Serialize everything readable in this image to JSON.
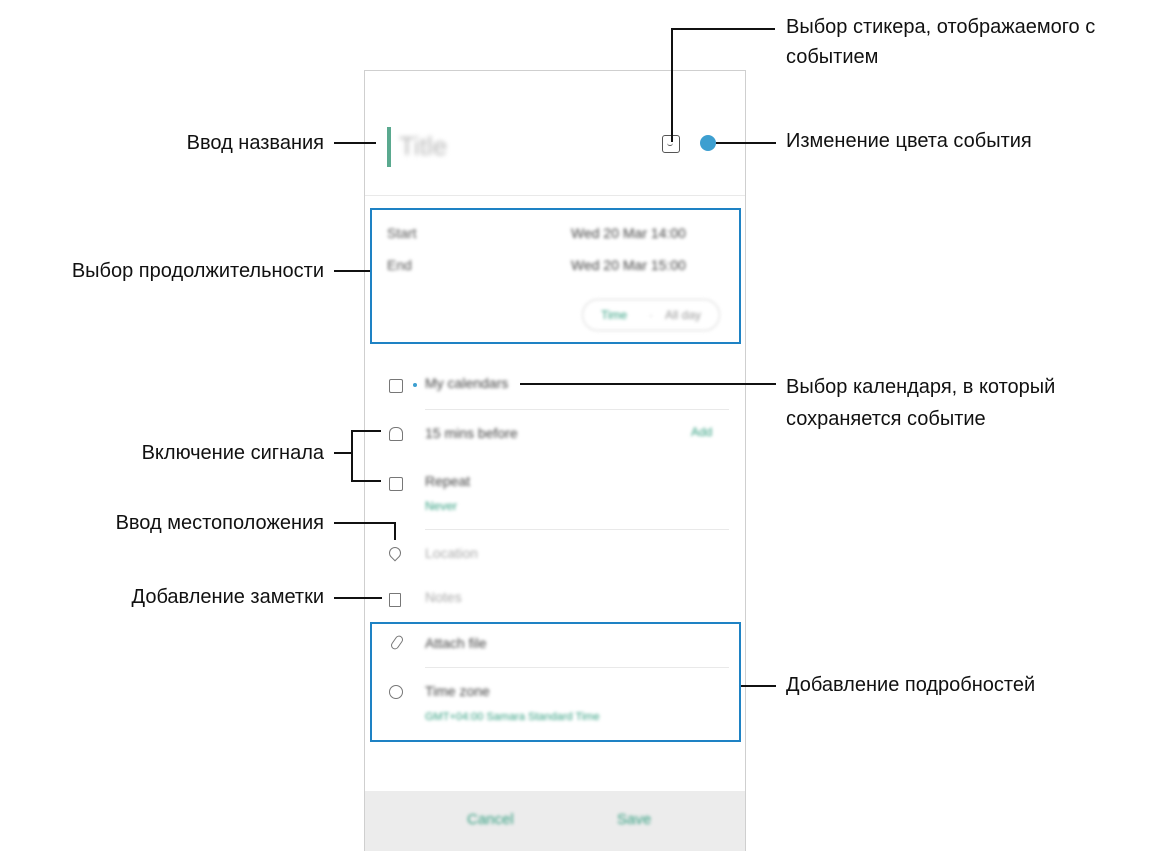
{
  "screen": {
    "title_placeholder": "Title",
    "duration": {
      "start_label": "Start",
      "start_value": "Wed 20 Mar 14:00",
      "end_label": "End",
      "end_value": "Wed 20 Mar 15:00",
      "toggle_time": "Time",
      "toggle_allday": "All day"
    },
    "calendar": "My calendars",
    "alarm": {
      "value": "15 mins before",
      "action": "Add"
    },
    "repeat": {
      "label": "Repeat",
      "value": "Never"
    },
    "location_placeholder": "Location",
    "notes_placeholder": "Notes",
    "attach": "Attach file",
    "timezone": {
      "label": "Time zone",
      "value": "GMT+04:00 Samara Standard Time"
    },
    "cancel_label": "Cancel",
    "save_label": "Save"
  },
  "callouts": {
    "sticker": "Выбор стикера, отображаемого с событием",
    "sticker_line1": "Выбор стикера, отображаемого с",
    "sticker_line2": "событием",
    "title": "Ввод названия",
    "color": "Изменение цвета события",
    "duration": "Выбор продолжительности",
    "calendar_line1": "Выбор календаря, в который",
    "calendar_line2": "сохраняется событие",
    "alarm": "Включение сигнала",
    "location": "Ввод местоположения",
    "notes": "Добавление заметки",
    "details": "Добавление подробностей"
  },
  "colors": {
    "accent": "#2f9d7e",
    "event_color": "#3d9fd0",
    "highlight": "#1e82c4"
  },
  "icons": [
    "sticker-icon",
    "calendar-icon",
    "bell-icon",
    "repeat-icon",
    "location-pin-icon",
    "notes-icon",
    "paperclip-icon",
    "globe-icon"
  ]
}
